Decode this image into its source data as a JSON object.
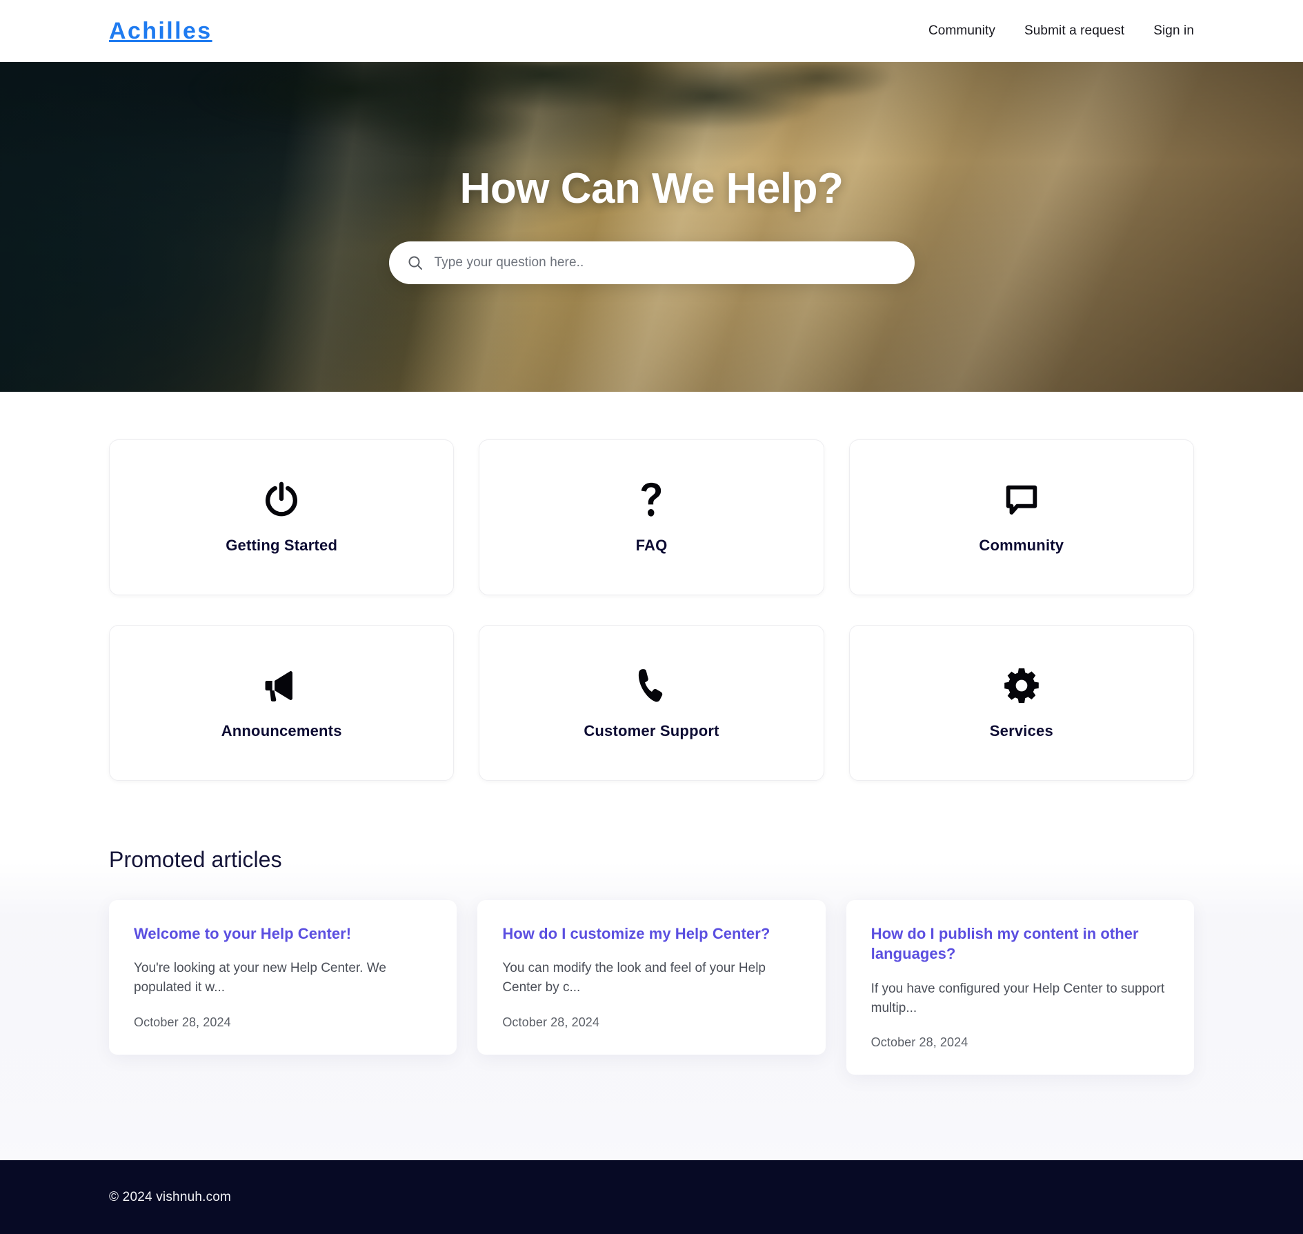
{
  "header": {
    "logo": "Achilles",
    "nav": [
      {
        "label": "Community",
        "name": "nav-community"
      },
      {
        "label": "Submit a request",
        "name": "nav-submit-request"
      },
      {
        "label": "Sign in",
        "name": "nav-sign-in"
      }
    ]
  },
  "hero": {
    "title": "How Can We Help?",
    "search_placeholder": "Type your question here..",
    "search_value": "",
    "search_icon": "search-icon"
  },
  "categories": [
    {
      "label": "Getting Started",
      "icon": "power-icon"
    },
    {
      "label": "FAQ",
      "icon": "question-mark-icon"
    },
    {
      "label": "Community",
      "icon": "chat-bubble-icon"
    },
    {
      "label": "Announcements",
      "icon": "megaphone-icon"
    },
    {
      "label": "Customer Support",
      "icon": "phone-icon"
    },
    {
      "label": "Services",
      "icon": "gear-icon"
    }
  ],
  "promoted": {
    "title": "Promoted articles",
    "articles": [
      {
        "title": "Welcome to your Help Center!",
        "excerpt": "You're looking at your new Help Center. We populated it w...",
        "date": "October 28, 2024"
      },
      {
        "title": "How do I customize my Help Center?",
        "excerpt": "You can modify the look and feel of your Help Center by c...",
        "date": "October 28, 2024"
      },
      {
        "title": "How do I publish my content in other languages?",
        "excerpt": "If you have configured your Help Center to support multip...",
        "date": "October 28, 2024"
      }
    ]
  },
  "footer": {
    "copyright": "© 2024 vishnuh.com"
  },
  "colors": {
    "logo_blue": "#1f7bf0",
    "article_link": "#5b4fe0",
    "category_label": "#0d0c33",
    "footer_bg": "#070a25"
  }
}
